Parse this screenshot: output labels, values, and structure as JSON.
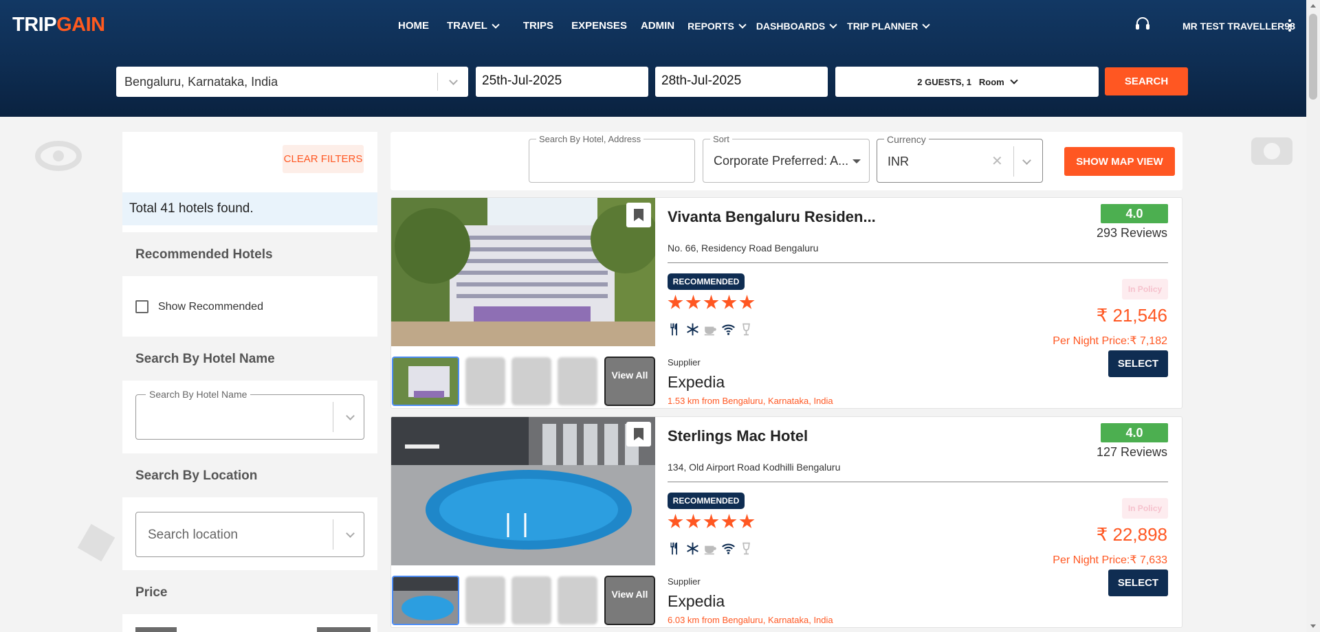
{
  "header": {
    "logo_part1": "TRIP",
    "logo_part2": "GAIN",
    "nav": [
      {
        "label": "HOME",
        "dropdown": false
      },
      {
        "label": "TRAVEL",
        "dropdown": true
      },
      {
        "label": "TRIPS",
        "dropdown": false
      },
      {
        "label": "EXPENSES",
        "dropdown": false
      },
      {
        "label": "ADMIN",
        "dropdown": false
      },
      {
        "label": "REPORTS",
        "dropdown": true
      },
      {
        "label": "DASHBOARDS",
        "dropdown": true
      },
      {
        "label": "TRIP PLANNER",
        "dropdown": true
      }
    ],
    "user_name": "MR TEST TRAVELLER98"
  },
  "search": {
    "location": "Bengaluru, Karnataka, India",
    "checkin": "25th-Jul-2025",
    "checkout": "28th-Jul-2025",
    "guests": "2 GUESTS, 1",
    "room_label": "Room",
    "search_button": "SEARCH"
  },
  "sidebar": {
    "clear_filters": "CLEAR FILTERS",
    "total": "Total 41 hotels found.",
    "recommended_title": "Recommended Hotels",
    "show_recommended": "Show Recommended",
    "hotel_name_title": "Search By Hotel Name",
    "hotel_name_field_label": "Search By Hotel Name",
    "location_title": "Search By Location",
    "location_placeholder": "Search location",
    "price_title": "Price"
  },
  "toolbar": {
    "search_label": "Search By Hotel, Address",
    "sort_label": "Sort",
    "sort_value": "Corporate Preferred: A...",
    "currency_label": "Currency",
    "currency_value": "INR",
    "map_button": "SHOW MAP VIEW"
  },
  "hotels": [
    {
      "name": "Vivanta Bengaluru Residen...",
      "address": "No. 66, Residency Road Bengaluru",
      "rating": "4.0",
      "reviews": "293 Reviews",
      "badge": "RECOMMENDED",
      "stars": 5,
      "policy": "In Policy",
      "price": "₹ 21,546",
      "per_night": "Per Night Price:₹ 7,182",
      "select": "SELECT",
      "supplier_label": "Supplier",
      "supplier": "Expedia",
      "distance": "1.53 km from Bengaluru, Karnataka, India",
      "view_all": "View All"
    },
    {
      "name": "Sterlings Mac Hotel",
      "address": "134, Old Airport Road Kodhilli Bengaluru",
      "rating": "4.0",
      "reviews": "127 Reviews",
      "badge": "RECOMMENDED",
      "stars": 5,
      "policy": "In Policy",
      "price": "₹ 22,898",
      "per_night": "Per Night Price:₹ 7,633",
      "select": "SELECT",
      "supplier_label": "Supplier",
      "supplier": "Expedia",
      "distance": "6.03 km from Bengaluru, Karnataka, India",
      "view_all": "View All"
    }
  ],
  "colors": {
    "header_bg": "#0e2d52",
    "accent": "#ff5722",
    "navy": "#0f2d52",
    "rating_green": "#4caf50"
  }
}
